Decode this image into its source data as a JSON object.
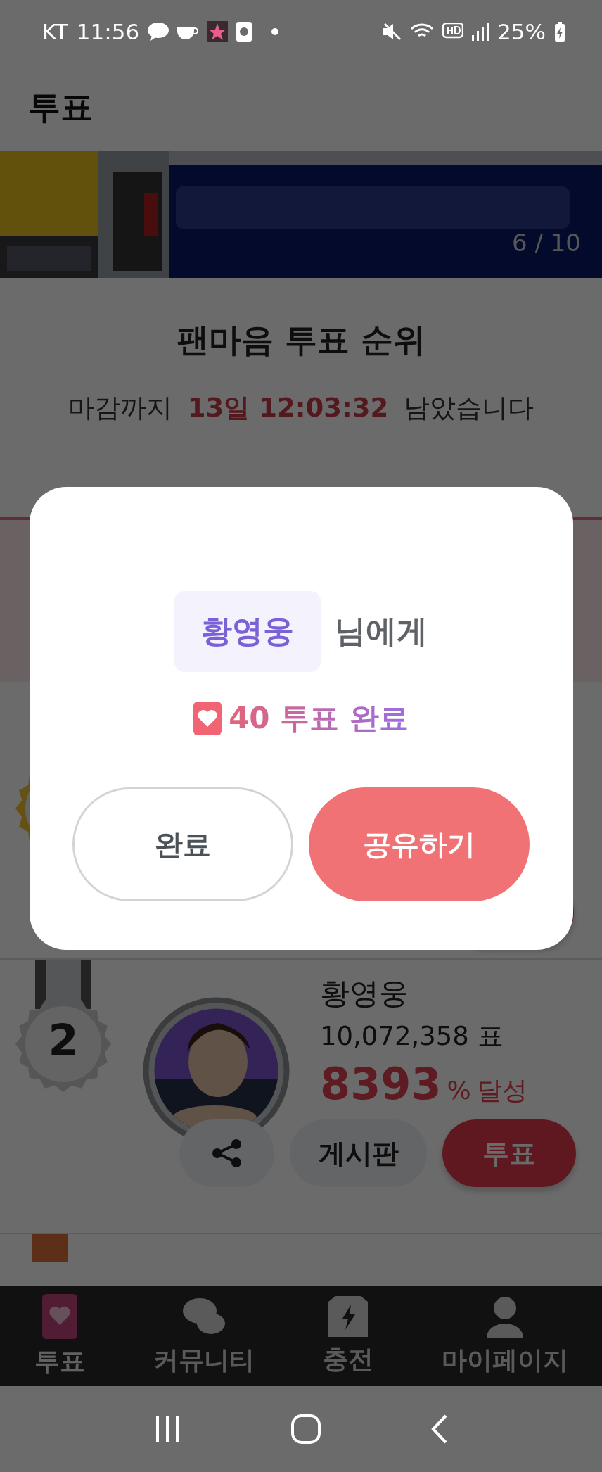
{
  "status_bar": {
    "carrier": "KT",
    "time": "11:56",
    "battery": "25%"
  },
  "header": {
    "title": "투표"
  },
  "banner": {
    "kind": "picture",
    "counter": "6 / 10"
  },
  "ranking": {
    "title": "팬마음 투표 순위",
    "deadline_prefix": "마감까지",
    "countdown": "13일 12:03:32",
    "deadline_suffix": "남았습니다",
    "entries": [
      {
        "kind": "gold"
      },
      {
        "kind": "silver",
        "rank": "2",
        "name": "황영웅",
        "votes": "10,072,358 표",
        "percent": "8393",
        "percent_unit": "%",
        "achieved": "달성",
        "board": "게시판",
        "vote": "투표"
      },
      {
        "kind": "bronze"
      }
    ]
  },
  "bottom_nav": [
    {
      "label": "투표",
      "kind": "vote",
      "selected": true
    },
    {
      "label": "커뮤니티",
      "kind": "community",
      "selected": false
    },
    {
      "label": "충전",
      "kind": "charge",
      "selected": false
    },
    {
      "label": "마이페이지",
      "kind": "mypage",
      "selected": false
    }
  ],
  "dialog": {
    "recipient": "황영웅",
    "recipient_suffix": "님에게",
    "result": "40 투표 완료",
    "buttons": [
      {
        "label": "완료",
        "kind": "secondary"
      },
      {
        "label": "공유하기",
        "kind": "primary"
      }
    ]
  }
}
